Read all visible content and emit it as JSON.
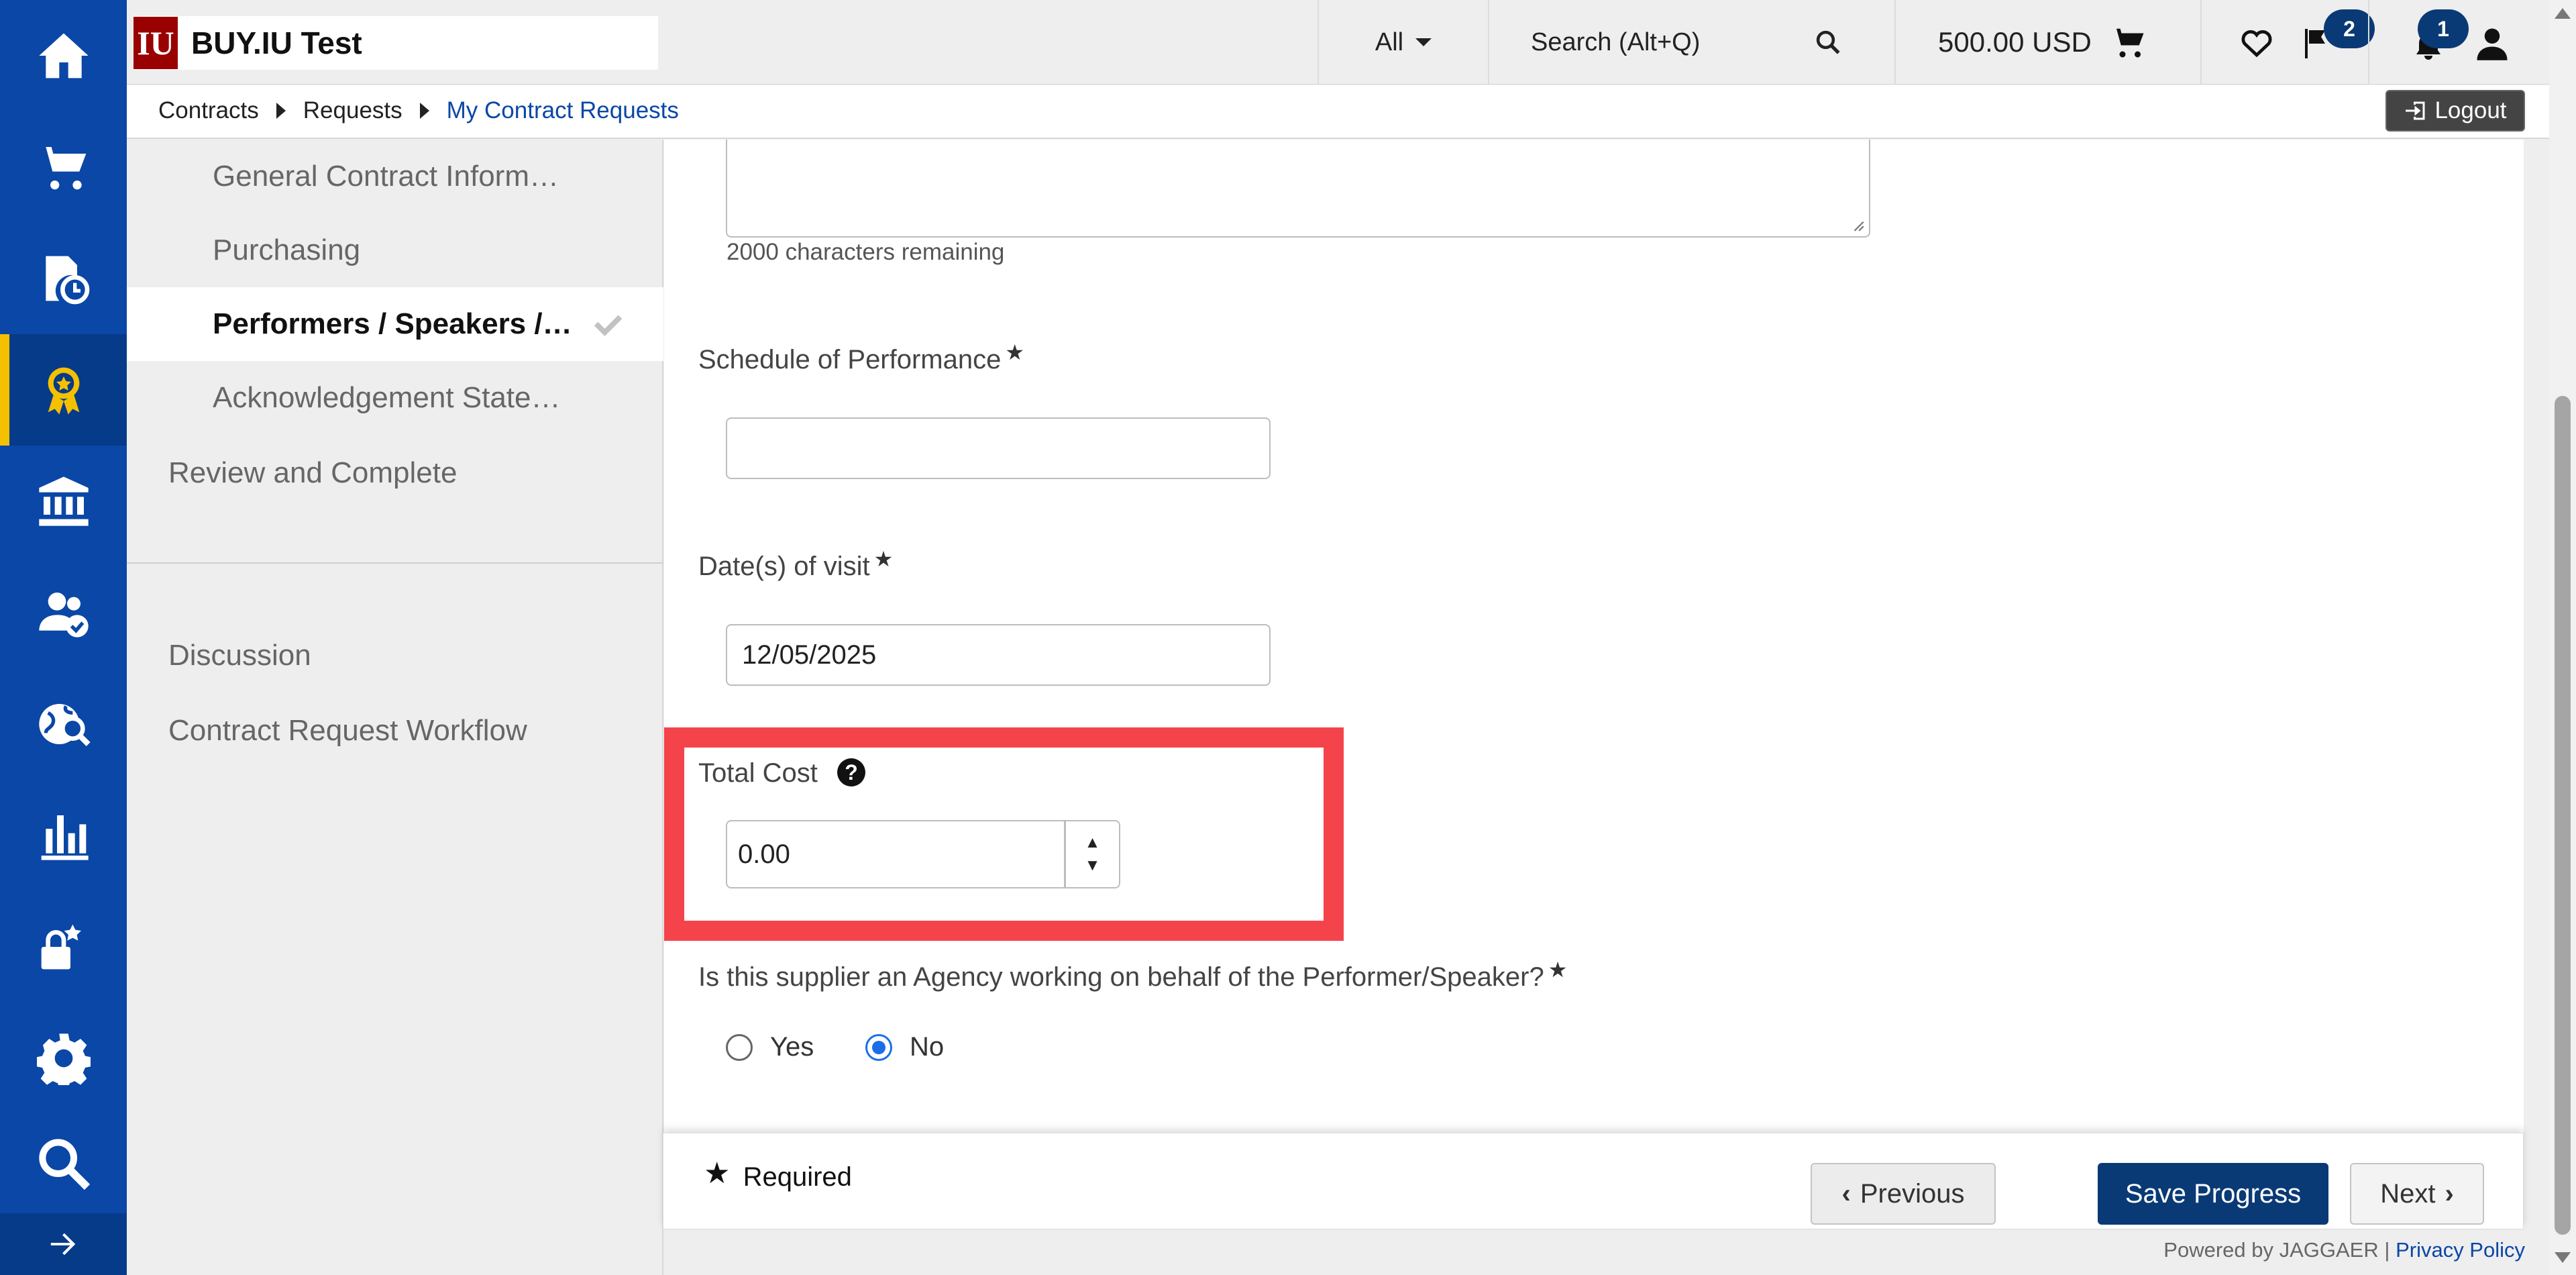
{
  "app": {
    "title": "BUY.IU Test",
    "brand_mark": "IU"
  },
  "header": {
    "search_scope": "All",
    "search_placeholder": "Search (Alt+Q)",
    "cart_total": "500.00 USD",
    "flag_badge": "2",
    "notification_badge": "1"
  },
  "rail": {
    "items": [
      "home-icon",
      "shop-icon",
      "orders-icon",
      "contracts-icon",
      "accounts-payable-icon",
      "suppliers-icon",
      "sourcing-icon",
      "reports-icon",
      "admin-icon",
      "setup-icon",
      "search-icon"
    ],
    "active_index": 3
  },
  "breadcrumb": {
    "items": [
      "Contracts",
      "Requests"
    ],
    "current": "My Contract Requests"
  },
  "logout_label": "Logout",
  "section_nav": {
    "sub_items": [
      {
        "label": "General Contract Informat…",
        "status": "complete-gray"
      },
      {
        "label": "Purchasing",
        "status": "complete-green"
      },
      {
        "label": "Performers / Speakers / …",
        "status": "complete-gray",
        "current": true
      },
      {
        "label": "Acknowledgement State…",
        "status": "complete-gray"
      }
    ],
    "review_label": "Review and Complete",
    "discussion_label": "Discussion",
    "workflow_label": "Contract Request Workflow"
  },
  "form": {
    "char_remaining": "2000 characters remaining",
    "schedule_label": "Schedule of Performance",
    "schedule_value": "",
    "dates_label": "Date(s) of visit",
    "dates_value": "12/05/2025",
    "total_cost_label": "Total Cost",
    "total_cost_value": "0.00",
    "agency_question": "Is this supplier an Agency working on behalf of the Performer/Speaker?",
    "agency_options": [
      "Yes",
      "No"
    ],
    "agency_selected": "No",
    "required_star": "★"
  },
  "footer": {
    "required_note": "Required",
    "previous_label": "Previous",
    "save_label": "Save Progress",
    "next_label": "Next",
    "powered_by": "Powered by JAGGAER",
    "separator": "|",
    "privacy_label": "Privacy Policy"
  },
  "colors": {
    "rail": "#0a47a6",
    "rail_active_marker": "#f5c000",
    "primary_button": "#0a3a75",
    "highlight": "#f5434b",
    "check_green": "#17874a",
    "check_gray": "#c2c2c2"
  }
}
